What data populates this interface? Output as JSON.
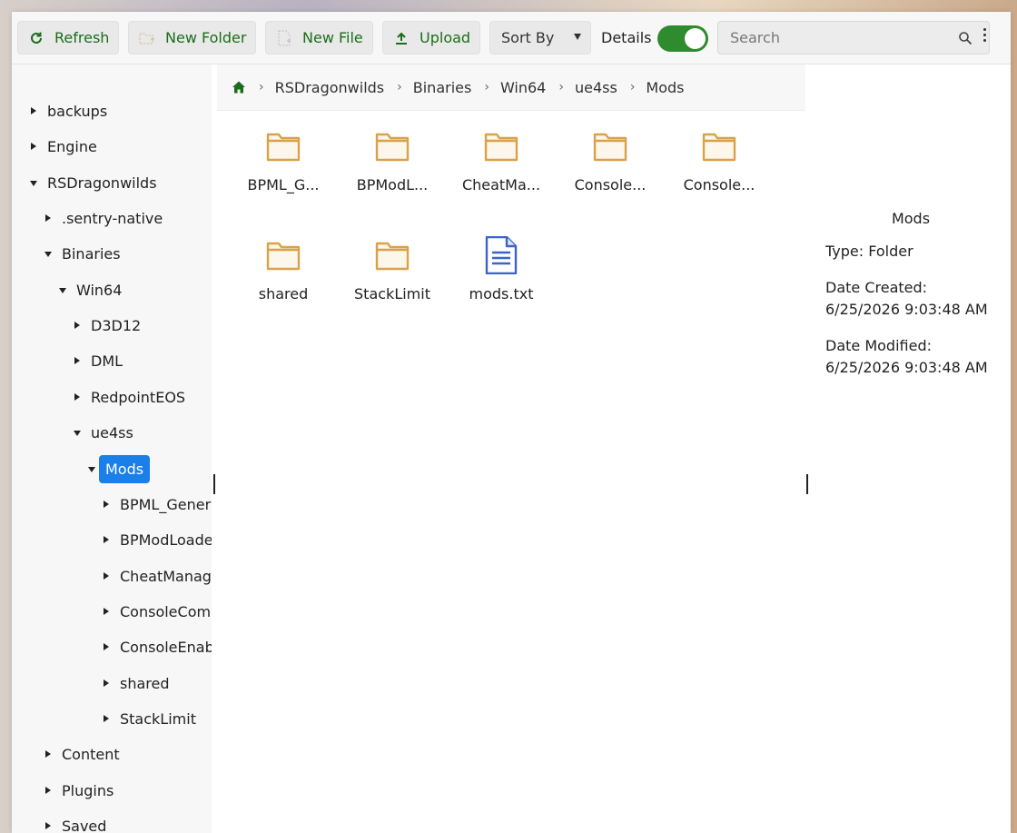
{
  "toolbar": {
    "refresh_label": "Refresh",
    "new_folder_label": "New Folder",
    "new_file_label": "New File",
    "upload_label": "Upload",
    "sort_by_label": "Sort By",
    "details_label": "Details",
    "details_enabled": true,
    "search_placeholder": "Search"
  },
  "tree": [
    {
      "label": "backups",
      "expanded": false
    },
    {
      "label": "Engine",
      "expanded": false
    },
    {
      "label": "RSDragonwilds",
      "expanded": true
    },
    {
      "label": ".sentry-native",
      "expanded": false
    },
    {
      "label": "Binaries",
      "expanded": true
    },
    {
      "label": "Win64",
      "expanded": true
    },
    {
      "label": "D3D12",
      "expanded": false
    },
    {
      "label": "DML",
      "expanded": false
    },
    {
      "label": "RedpointEOS",
      "expanded": false
    },
    {
      "label": "ue4ss",
      "expanded": true
    },
    {
      "label": "Mods",
      "expanded": true,
      "selected": true
    },
    {
      "label": "BPML_GenericFunctions",
      "expanded": false
    },
    {
      "label": "BPModLoaderMod",
      "expanded": false
    },
    {
      "label": "CheatManagerEnablerMod",
      "expanded": false
    },
    {
      "label": "ConsoleCommandsMod",
      "expanded": false
    },
    {
      "label": "ConsoleEnablerMod",
      "expanded": false
    },
    {
      "label": "shared",
      "expanded": false
    },
    {
      "label": "StackLimit",
      "expanded": false
    },
    {
      "label": "Content",
      "expanded": false
    },
    {
      "label": "Plugins",
      "expanded": false
    },
    {
      "label": "Saved",
      "expanded": false
    }
  ],
  "breadcrumb": [
    "RSDragonwilds",
    "Binaries",
    "Win64",
    "ue4ss",
    "Mods"
  ],
  "files": [
    {
      "name": "BPML_G...",
      "type": "folder"
    },
    {
      "name": "BPModL...",
      "type": "folder"
    },
    {
      "name": "CheatMa...",
      "type": "folder"
    },
    {
      "name": "Console...",
      "type": "folder"
    },
    {
      "name": "Console...",
      "type": "folder"
    },
    {
      "name": "shared",
      "type": "folder"
    },
    {
      "name": "StackLimit",
      "type": "folder"
    },
    {
      "name": "mods.txt",
      "type": "file"
    }
  ],
  "details": {
    "name": "Mods",
    "type_line": "Type: Folder",
    "created_label": "Date Created:",
    "created_value": "6/25/2026 9:03:48 AM",
    "modified_label": "Date Modified:",
    "modified_value": "6/25/2026 9:03:48 AM"
  },
  "colors": {
    "accent": "#1a7fe8",
    "toolbar_text": "#1a6d1a",
    "toggle_on": "#2e8b2e",
    "folder": "#d9a24a",
    "file": "#3d63c9"
  }
}
